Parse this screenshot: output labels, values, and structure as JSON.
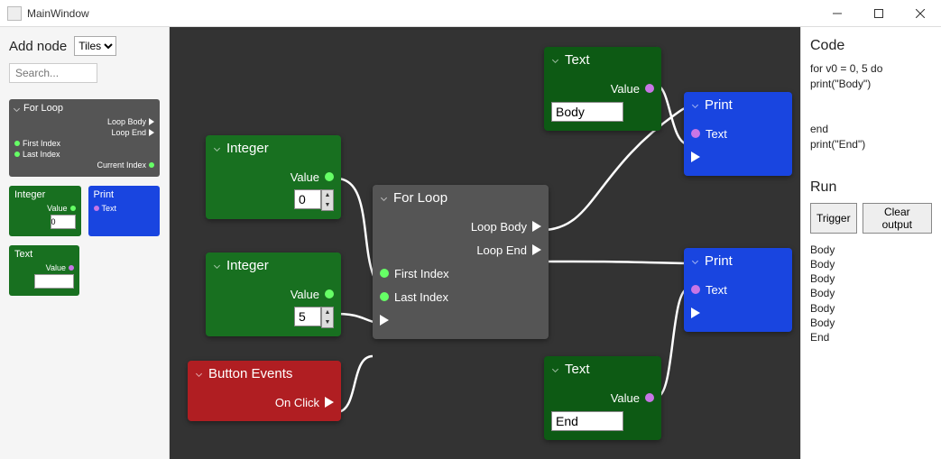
{
  "window": {
    "title": "MainWindow"
  },
  "sidebar": {
    "heading": "Add node",
    "view_mode": "Tiles",
    "search_placeholder": "Search...",
    "previews": {
      "forloop": {
        "title": "For Loop",
        "p_body": "Loop Body",
        "p_end": "Loop End",
        "p_first": "First Index",
        "p_last": "Last Index",
        "p_cur": "Current Index"
      },
      "integer": {
        "title": "Integer",
        "p_value": "Value",
        "input": "0"
      },
      "print": {
        "title": "Print",
        "p_text": "Text"
      },
      "text": {
        "title": "Text",
        "p_value": "Value",
        "input": ""
      }
    }
  },
  "canvas": {
    "integer1": {
      "title": "Integer",
      "p_value": "Value",
      "input": "0"
    },
    "integer2": {
      "title": "Integer",
      "p_value": "Value",
      "input": "5"
    },
    "button": {
      "title": "Button Events",
      "p_click": "On Click"
    },
    "forloop": {
      "title": "For Loop",
      "p_body": "Loop Body",
      "p_end": "Loop End",
      "p_first": "First Index",
      "p_last": "Last Index"
    },
    "text1": {
      "title": "Text",
      "p_value": "Value",
      "input": "Body"
    },
    "text2": {
      "title": "Text",
      "p_value": "Value",
      "input": "End"
    },
    "print1": {
      "title": "Print",
      "p_text": "Text"
    },
    "print2": {
      "title": "Print",
      "p_text": "Text"
    }
  },
  "right": {
    "code_heading": "Code",
    "code": "for v0 = 0, 5 do\nprint(\"Body\")\n\n\nend\nprint(\"End\")",
    "run_heading": "Run",
    "trigger": "Trigger",
    "clear": "Clear output",
    "output": [
      "Body",
      "Body",
      "Body",
      "Body",
      "Body",
      "Body",
      "End"
    ]
  }
}
